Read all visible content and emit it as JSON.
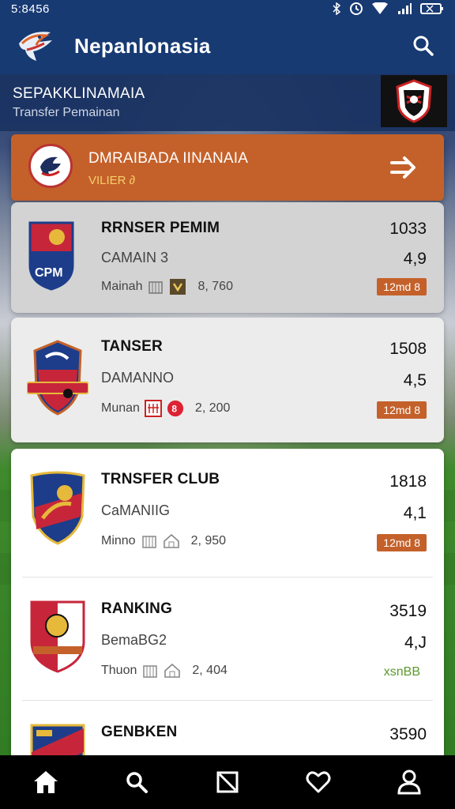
{
  "status": {
    "time": "5:8456"
  },
  "app": {
    "title": "Nepanlonasia"
  },
  "subheader": {
    "line1": "SEPAKKLINAMAIA",
    "line2": "Transfer Pemainan"
  },
  "banner": {
    "title": "DMRAIBADA IINANAIA",
    "subtitle": "VILIER ∂"
  },
  "items": [
    {
      "name": "RRNSER PEMIM",
      "sub": "CAMAIN 3",
      "meta": "Mainah",
      "count": "8, 760",
      "score": "1033",
      "rating": "4,9",
      "tag": "12md 8"
    },
    {
      "name": "TANSER",
      "sub": "DAMANNO",
      "meta": "Munan",
      "count": "2, 200",
      "score": "1508",
      "rating": "4,5",
      "tag": "12md 8"
    },
    {
      "name": "TRNSFER CLUB",
      "sub": "CaMANIIG",
      "meta": "Minno",
      "count": "2, 950",
      "score": "1818",
      "rating": "4,1",
      "tag": "12md 8"
    },
    {
      "name": "RANKING",
      "sub": "BemaBG2",
      "meta": "Thuon",
      "count": "2, 404",
      "score": "3519",
      "rating": "4,J",
      "tag": "xsnBB"
    },
    {
      "name": "GENBKEN",
      "sub": "",
      "meta": "",
      "count": "",
      "score": "3590",
      "rating": "",
      "tag": ""
    }
  ],
  "colors": {
    "appbar": "#173a73",
    "accent": "#c4612a",
    "tag_green": "#5a9a2a"
  },
  "icons": {
    "nav": [
      "home-icon",
      "search-icon",
      "square-slash-icon",
      "heart-icon",
      "user-icon"
    ]
  }
}
